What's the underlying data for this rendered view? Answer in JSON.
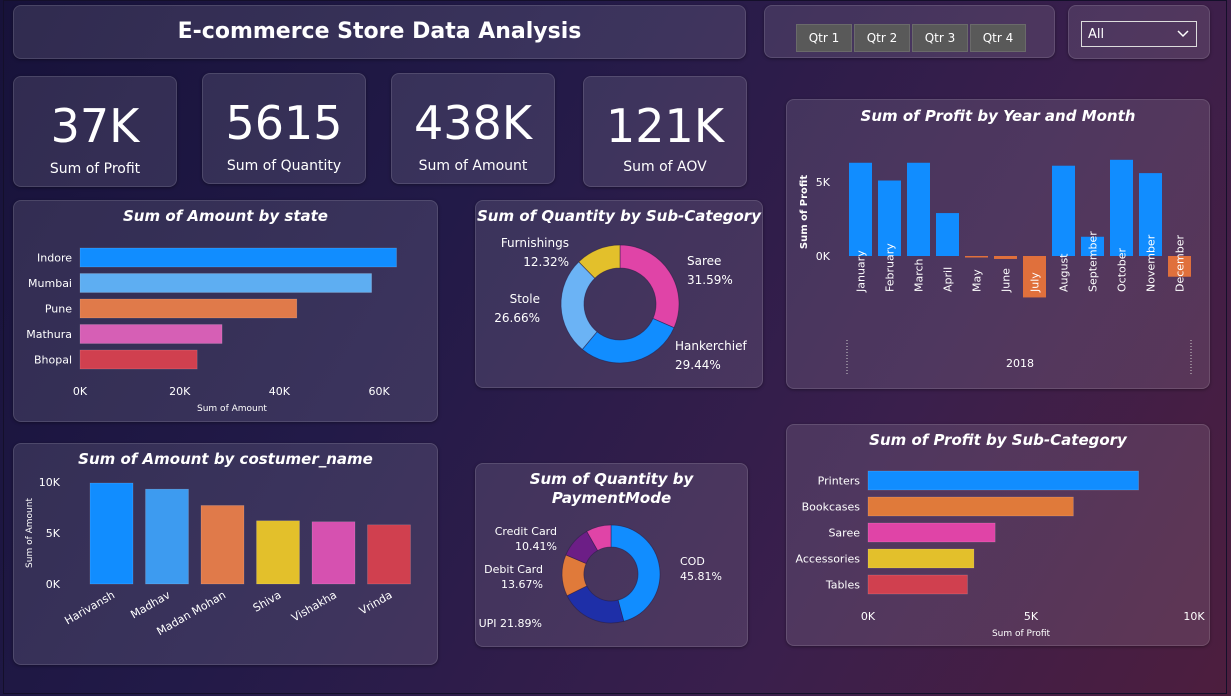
{
  "header": {
    "title": "E-commerce Store Data Analysis"
  },
  "quarters": [
    {
      "label": "Qtr 1"
    },
    {
      "label": "Qtr 2"
    },
    {
      "label": "Qtr 3"
    },
    {
      "label": "Qtr 4"
    }
  ],
  "filter": {
    "selected": "All",
    "icon": "chevron-down-icon"
  },
  "kpis": [
    {
      "value": "37K",
      "label": "Sum of Profit"
    },
    {
      "value": "5615",
      "label": "Sum of Quantity"
    },
    {
      "value": "438K",
      "label": "Sum of Amount"
    },
    {
      "value": "121K",
      "label": "Sum of AOV"
    }
  ],
  "chart_data": [
    {
      "id": "state",
      "type": "bar",
      "orientation": "horizontal",
      "title": "Sum of Amount by state",
      "xlabel": "Sum of Amount",
      "categories": [
        "Indore",
        "Mumbai",
        "Pune",
        "Mathura",
        "Bhopal"
      ],
      "values": [
        63500,
        58500,
        43500,
        28500,
        23500
      ],
      "colors": [
        "#118DFF",
        "#5EAEF2",
        "#E07A4A",
        "#D65FB5",
        "#D0404F"
      ],
      "xlim": [
        0,
        65000
      ],
      "ticks": [
        0,
        20000,
        40000,
        60000
      ],
      "tick_labels": [
        "0K",
        "20K",
        "40K",
        "60K"
      ]
    },
    {
      "id": "subcat_qty",
      "type": "pie",
      "donut": true,
      "title": "Sum of Quantity by Sub-Category",
      "slices": [
        {
          "name": "Saree",
          "pct": "31.59%",
          "value": 31.59,
          "color": "#E044A7"
        },
        {
          "name": "Hankerchief",
          "pct": "29.44%",
          "value": 29.44,
          "color": "#118DFF"
        },
        {
          "name": "Stole",
          "pct": "26.66%",
          "value": 26.66,
          "color": "#6BB3F5"
        },
        {
          "name": "Furnishings",
          "pct": "12.32%",
          "value": 12.32,
          "color": "#E3C02B"
        }
      ]
    },
    {
      "id": "profit_month",
      "type": "bar",
      "title": "Sum of Profit by Year and Month",
      "ylabel": "Sum of Profit",
      "xgroup": "2018",
      "categories": [
        "January",
        "February",
        "March",
        "April",
        "May",
        "June",
        "July",
        "August",
        "September",
        "October",
        "November",
        "December"
      ],
      "values": [
        6300,
        5100,
        6300,
        2900,
        -100,
        -200,
        -2800,
        6100,
        1300,
        6500,
        5600,
        -1400
      ],
      "color_positive": "#118DFF",
      "color_negative": "#E0703C",
      "ylim": [
        -3000,
        7000
      ],
      "ticks": [
        0,
        5000
      ],
      "tick_labels": [
        "0K",
        "5K"
      ]
    },
    {
      "id": "customer",
      "type": "bar",
      "title": "Sum of Amount by costumer_name",
      "ylabel": "Sum of Amount",
      "categories": [
        "Harivansh",
        "Madhav",
        "Madan Mohan",
        "Shiva",
        "Vishakha",
        "Vrinda"
      ],
      "values": [
        9900,
        9300,
        7700,
        6200,
        6100,
        5800
      ],
      "colors": [
        "#118DFF",
        "#3D9BF0",
        "#E07A4A",
        "#E3C02B",
        "#D651B0",
        "#D0404F"
      ],
      "ylim": [
        0,
        10000
      ],
      "ticks": [
        0,
        5000,
        10000
      ],
      "tick_labels": [
        "0K",
        "5K",
        "10K"
      ]
    },
    {
      "id": "payment",
      "type": "pie",
      "donut": true,
      "title_line1": "Sum of Quantity by",
      "title_line2": "PaymentMode",
      "slices": [
        {
          "name": "COD",
          "pct": "45.81%",
          "value": 45.81,
          "color": "#118DFF"
        },
        {
          "name": "UPI",
          "pct": "21.89%",
          "value": 21.89,
          "color": "#1E2FA8"
        },
        {
          "name": "Debit Card",
          "pct": "13.67%",
          "value": 13.67,
          "color": "#E07A3A"
        },
        {
          "name": "Credit Card",
          "pct": "10.41%",
          "value": 10.41,
          "color": "#6C1E86"
        },
        {
          "name": "",
          "pct": "",
          "value": 8.22,
          "color": "#E044A7"
        }
      ],
      "upi_label": "UPI 21.89%"
    },
    {
      "id": "profit_subcat",
      "type": "bar",
      "orientation": "horizontal",
      "title": "Sum of Profit by Sub-Category",
      "xlabel": "Sum of Profit",
      "categories": [
        "Printers",
        "Bookcases",
        "Saree",
        "Accessories",
        "Tables"
      ],
      "values": [
        8300,
        6300,
        3900,
        3250,
        3050
      ],
      "colors": [
        "#118DFF",
        "#E07A3A",
        "#E044A7",
        "#E3C02B",
        "#D0404F"
      ],
      "xlim": [
        0,
        10000
      ],
      "ticks": [
        0,
        5000,
        10000
      ],
      "tick_labels": [
        "0K",
        "5K",
        "10K"
      ]
    }
  ]
}
